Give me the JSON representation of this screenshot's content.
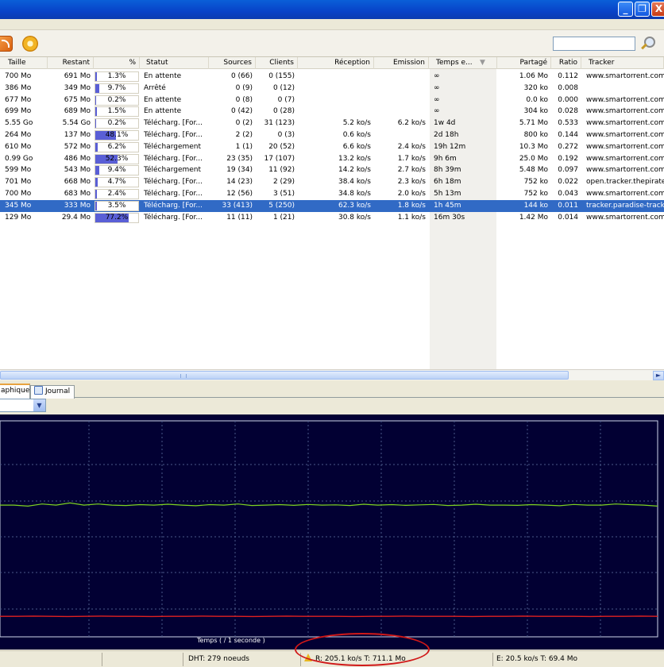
{
  "window": {
    "minimize": "_",
    "restore": "❐",
    "close": "X"
  },
  "search": {
    "value": "",
    "placeholder": ""
  },
  "columns": [
    "Taille",
    "Restant",
    "%",
    "Statut",
    "Sources",
    "Clients",
    "Réception",
    "Emission",
    "Temps e...",
    "Partagé",
    "Ratio",
    "Tracker"
  ],
  "rows": [
    {
      "taille": "700 Mo",
      "restant": "691 Mo",
      "pct": "1.3%",
      "pct_value": 0.013,
      "statut": "En attente",
      "sources": "0 (66)",
      "clients": "0 (155)",
      "reception": "",
      "emission": "",
      "temps": "∞",
      "partage": "1.06 Mo",
      "ratio": "0.112",
      "tracker": "www.smartorrent.com"
    },
    {
      "taille": "386 Mo",
      "restant": "349 Mo",
      "pct": "9.7%",
      "pct_value": 0.097,
      "statut": "Arrêté",
      "sources": "0 (9)",
      "clients": "0 (12)",
      "reception": "",
      "emission": "",
      "temps": "∞",
      "partage": "320 ko",
      "ratio": "0.008",
      "tracker": ""
    },
    {
      "taille": "677 Mo",
      "restant": "675 Mo",
      "pct": "0.2%",
      "pct_value": 0.002,
      "statut": "En attente",
      "sources": "0 (8)",
      "clients": "0 (7)",
      "reception": "",
      "emission": "",
      "temps": "∞",
      "partage": "0.0 ko",
      "ratio": "0.000",
      "tracker": "www.smartorrent.com"
    },
    {
      "taille": "699 Mo",
      "restant": "689 Mo",
      "pct": "1.5%",
      "pct_value": 0.015,
      "statut": "En attente",
      "sources": "0 (42)",
      "clients": "0 (28)",
      "reception": "",
      "emission": "",
      "temps": "∞",
      "partage": "304 ko",
      "ratio": "0.028",
      "tracker": "www.smartorrent.com"
    },
    {
      "taille": "5.55 Go",
      "restant": "5.54 Go",
      "pct": "0.2%",
      "pct_value": 0.002,
      "statut": "Télécharg. [For...",
      "sources": "0 (2)",
      "clients": "31 (123)",
      "reception": "5.2 ko/s",
      "emission": "6.2 ko/s",
      "temps": "1w 4d",
      "partage": "5.71 Mo",
      "ratio": "0.533",
      "tracker": "www.smartorrent.com"
    },
    {
      "taille": "264 Mo",
      "restant": "137 Mo",
      "pct": "48.1%",
      "pct_value": 0.481,
      "statut": "Télécharg. [For...",
      "sources": "2 (2)",
      "clients": "0 (3)",
      "reception": "0.6 ko/s",
      "emission": "",
      "temps": "2d 18h",
      "partage": "800 ko",
      "ratio": "0.144",
      "tracker": "www.smartorrent.com"
    },
    {
      "taille": "610 Mo",
      "restant": "572 Mo",
      "pct": "6.2%",
      "pct_value": 0.062,
      "statut": "Téléchargement",
      "sources": "1 (1)",
      "clients": "20 (52)",
      "reception": "6.6 ko/s",
      "emission": "2.4 ko/s",
      "temps": "19h 12m",
      "partage": "10.3 Mo",
      "ratio": "0.272",
      "tracker": "www.smartorrent.com"
    },
    {
      "taille": "0.99 Go",
      "restant": "486 Mo",
      "pct": "52.3%",
      "pct_value": 0.523,
      "statut": "Télécharg. [For...",
      "sources": "23 (35)",
      "clients": "17 (107)",
      "reception": "13.2 ko/s",
      "emission": "1.7 ko/s",
      "temps": "9h 6m",
      "partage": "25.0 Mo",
      "ratio": "0.192",
      "tracker": "www.smartorrent.com"
    },
    {
      "taille": "599 Mo",
      "restant": "543 Mo",
      "pct": "9.4%",
      "pct_value": 0.094,
      "statut": "Téléchargement",
      "sources": "19 (34)",
      "clients": "11 (92)",
      "reception": "14.2 ko/s",
      "emission": "2.7 ko/s",
      "temps": "8h 39m",
      "partage": "5.48 Mo",
      "ratio": "0.097",
      "tracker": "www.smartorrent.com"
    },
    {
      "taille": "701 Mo",
      "restant": "668 Mo",
      "pct": "4.7%",
      "pct_value": 0.047,
      "statut": "Télécharg. [For...",
      "sources": "14 (23)",
      "clients": "2 (29)",
      "reception": "38.4 ko/s",
      "emission": "2.3 ko/s",
      "temps": "6h 18m",
      "partage": "752 ko",
      "ratio": "0.022",
      "tracker": "open.tracker.thepiratel"
    },
    {
      "taille": "700 Mo",
      "restant": "683 Mo",
      "pct": "2.4%",
      "pct_value": 0.024,
      "statut": "Télécharg. [For...",
      "sources": "12 (56)",
      "clients": "3 (51)",
      "reception": "34.8 ko/s",
      "emission": "2.0 ko/s",
      "temps": "5h 13m",
      "partage": "752 ko",
      "ratio": "0.043",
      "tracker": "www.smartorrent.com"
    },
    {
      "taille": "345 Mo",
      "restant": "333 Mo",
      "pct": "3.5%",
      "pct_value": 0.035,
      "statut": "Télécharg. [For...",
      "sources": "33 (413)",
      "clients": "5 (250)",
      "reception": "62.3 ko/s",
      "emission": "1.8 ko/s",
      "temps": "1h 45m",
      "partage": "144 ko",
      "ratio": "0.011",
      "tracker": "tracker.paradise-tracke",
      "selected": true
    },
    {
      "taille": "129 Mo",
      "restant": "29.4 Mo",
      "pct": "77.2%",
      "pct_value": 0.772,
      "statut": "Télécharg. [For...",
      "sources": "11 (11)",
      "clients": "1 (21)",
      "reception": "30.8 ko/s",
      "emission": "1.1 ko/s",
      "temps": "16m 30s",
      "partage": "1.42 Mo",
      "ratio": "0.014",
      "tracker": "www.smartorrent.com"
    }
  ],
  "tabs": {
    "graph": "aphique",
    "journal": "Journal"
  },
  "graph_select": {
    "value": ""
  },
  "graph": {
    "caption": "Temps ( / 1 seconde )",
    "download_color": "#7ed321",
    "upload_color": "#e02020",
    "grid_color": "#4a5a8a",
    "download_series": [
      0.39,
      0.39,
      0.395,
      0.385,
      0.39,
      0.38,
      0.39,
      0.385,
      0.39,
      0.392,
      0.388,
      0.39,
      0.386,
      0.39,
      0.393,
      0.388,
      0.39,
      0.385,
      0.392,
      0.39,
      0.388,
      0.391,
      0.387,
      0.39,
      0.389,
      0.392,
      0.386,
      0.39,
      0.388,
      0.391,
      0.389,
      0.387,
      0.392,
      0.39,
      0.386,
      0.39,
      0.39,
      0.391,
      0.388,
      0.39,
      0.393,
      0.387,
      0.39,
      0.39,
      0.385,
      0.388,
      0.39,
      0.395
    ],
    "upload_series": [
      0.905,
      0.905,
      0.904,
      0.905,
      0.906,
      0.905,
      0.904,
      0.905,
      0.905,
      0.906,
      0.905,
      0.905,
      0.904,
      0.905,
      0.905,
      0.906,
      0.905,
      0.904,
      0.905,
      0.905,
      0.905,
      0.906,
      0.905,
      0.905,
      0.904,
      0.905,
      0.905,
      0.905,
      0.906,
      0.905,
      0.905,
      0.904,
      0.905,
      0.905,
      0.905,
      0.906,
      0.905,
      0.905,
      0.904,
      0.905
    ]
  },
  "status": {
    "dht": "DHT: 279 noeuds",
    "reception": "R: 205.1 ko/s T: 711.1 Mo",
    "emission": "E: 20.5 ko/s T: 69.4 Mo"
  }
}
